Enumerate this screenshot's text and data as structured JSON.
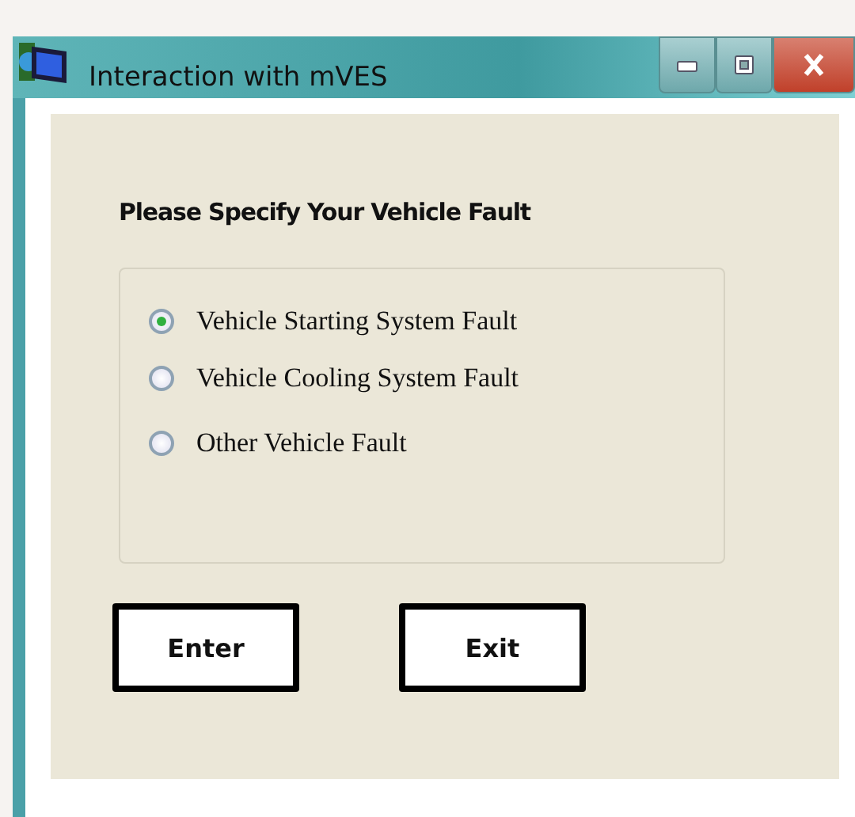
{
  "window": {
    "title": "Interaction with mVES"
  },
  "heading": "Please Specify Your Vehicle Fault",
  "options": [
    {
      "label": "Vehicle Starting System Fault",
      "selected": true
    },
    {
      "label": "Vehicle Cooling System Fault",
      "selected": false
    },
    {
      "label": "Other Vehicle Fault",
      "selected": false
    }
  ],
  "buttons": [
    "Enter",
    "Exit"
  ]
}
